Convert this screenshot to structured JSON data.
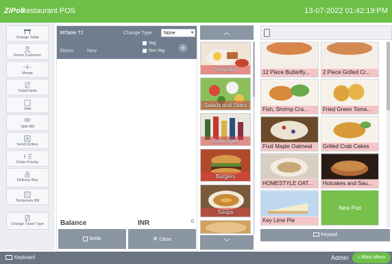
{
  "title_bar": {
    "logo": "ZiPos",
    "app_name": "Restaurant POS",
    "datetime": "13-07-2022 01:42:19:PM"
  },
  "sidebar": {
    "items": [
      {
        "label": "Change Table",
        "icon": "table-icon"
      },
      {
        "label": "Select Customer",
        "icon": "customer-icon"
      },
      {
        "label": "Merge",
        "icon": "merge-icon"
      },
      {
        "label": "Ticket Note",
        "icon": "note-icon"
      },
      {
        "label": "Void",
        "icon": "void-icon"
      },
      {
        "label": "Split Bill",
        "icon": "split-icon"
      },
      {
        "label": "Send Orders",
        "icon": "send-icon"
      },
      {
        "label": "Order Priority",
        "icon": "priority-icon"
      },
      {
        "label": "Delivery Boy",
        "icon": "delivery-icon"
      },
      {
        "label": "Temporary Bill",
        "icon": "bill-icon"
      },
      {
        "label": "Change Ticket Type",
        "icon": "ticket-icon"
      }
    ]
  },
  "order": {
    "table": "#8Table T2",
    "change_type_label": "Change Type",
    "change_type_value": "None",
    "status_label": "Status",
    "status_value": "New",
    "veg_label": "Veg",
    "nonveg_label": "Non Veg",
    "nonveg_checked": true,
    "balance_label": "Balance",
    "currency": "INR",
    "balance_value": "0",
    "settle_label": "Settle",
    "close_label": "Close"
  },
  "categories": [
    {
      "label": "Breakfast"
    },
    {
      "label": "Salads and Sides"
    },
    {
      "label": "Beverages"
    },
    {
      "label": "Burgers"
    },
    {
      "label": "Soups"
    }
  ],
  "items": [
    {
      "label": "12 Piece Butterfly..."
    },
    {
      "label": "2 Piece Grilled Cr..."
    },
    {
      "label": "Fish, Shrimp  Cra..."
    },
    {
      "label": "Fried Green Toma..."
    },
    {
      "label": "Fruit Maple Oatmeal"
    },
    {
      "label": "Grilled Crab Cakes"
    },
    {
      "label": "HOMESTYLE OAT..."
    },
    {
      "label": "Hotcakes and Sau..."
    },
    {
      "label": "Key Lime Pie"
    },
    {
      "label": "New Pod"
    }
  ],
  "keypad_label": "Keypad",
  "bottom_bar": {
    "keyboard_label": "Keyboard",
    "user": "Admin",
    "main_menu_label": "Main Menu"
  },
  "colors": {
    "brand_green": "#6dbf48",
    "panel_gray": "#707d8e",
    "button_gray": "#8b96a3"
  }
}
